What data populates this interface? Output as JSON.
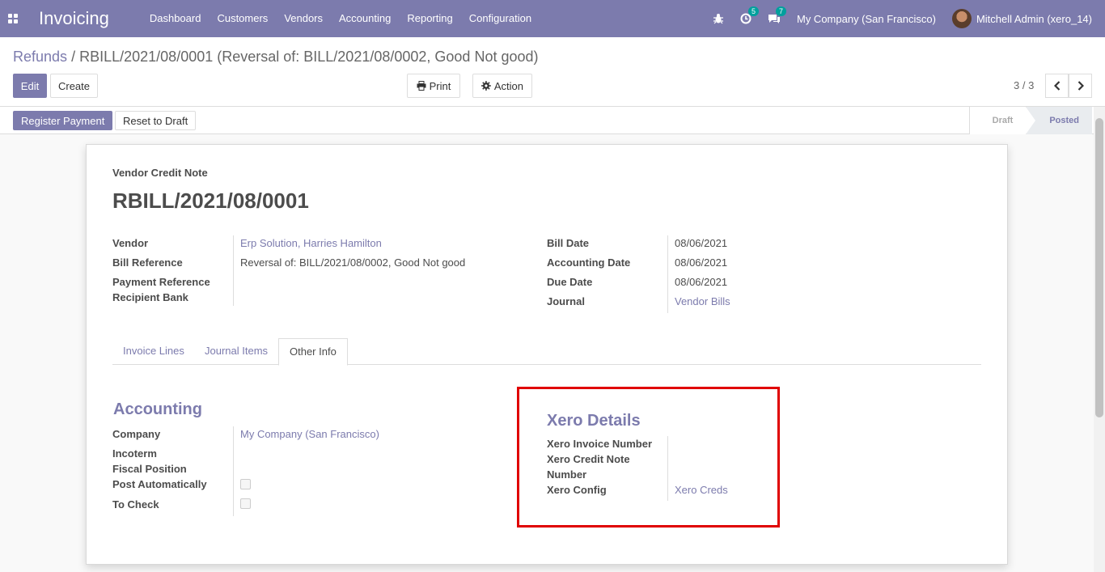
{
  "navbar": {
    "app_name": "Invoicing",
    "menu": [
      "Dashboard",
      "Customers",
      "Vendors",
      "Accounting",
      "Reporting",
      "Configuration"
    ],
    "activity_count": "5",
    "messages_count": "7",
    "company": "My Company (San Francisco)",
    "user": "Mitchell Admin (xero_14)"
  },
  "breadcrumb": {
    "parent": "Refunds",
    "separator": "/",
    "current": "RBILL/2021/08/0001 (Reversal of: BILL/2021/08/0002, Good Not good)"
  },
  "buttons": {
    "edit": "Edit",
    "create": "Create",
    "print": "Print",
    "action": "Action",
    "register_payment": "Register Payment",
    "reset_to_draft": "Reset to Draft"
  },
  "pager": {
    "value": "3 / 3"
  },
  "stages": [
    "Draft",
    "Posted"
  ],
  "colors": {
    "brand": "#7c7bad",
    "highlight": "#e00000"
  },
  "form": {
    "doc_type": "Vendor Credit Note",
    "title": "RBILL/2021/08/0001",
    "left_fields": {
      "vendor_label": "Vendor",
      "vendor_value": "Erp Solution, Harries Hamilton",
      "bill_ref_label": "Bill Reference",
      "bill_ref_value": "Reversal of: BILL/2021/08/0002, Good Not good",
      "payment_ref_label": "Payment Reference",
      "recipient_bank_label": "Recipient Bank"
    },
    "right_fields": {
      "bill_date_label": "Bill Date",
      "bill_date_value": "08/06/2021",
      "accounting_date_label": "Accounting Date",
      "accounting_date_value": "08/06/2021",
      "due_date_label": "Due Date",
      "due_date_value": "08/06/2021",
      "journal_label": "Journal",
      "journal_value": "Vendor Bills"
    },
    "tabs": [
      "Invoice Lines",
      "Journal Items",
      "Other Info"
    ],
    "accounting": {
      "title": "Accounting",
      "company_label": "Company",
      "company_value": "My Company (San Francisco)",
      "incoterm_label": "Incoterm",
      "fiscal_position_label": "Fiscal Position",
      "post_auto_label": "Post Automatically",
      "post_auto_checked": false,
      "to_check_label": "To Check",
      "to_check_checked": false
    },
    "xero": {
      "title": "Xero Details",
      "invoice_number_label": "Xero Invoice Number",
      "credit_note_label_line1": "Xero Credit Note",
      "credit_note_label_line2": "Number",
      "config_label": "Xero Config",
      "config_value": "Xero Creds"
    }
  }
}
